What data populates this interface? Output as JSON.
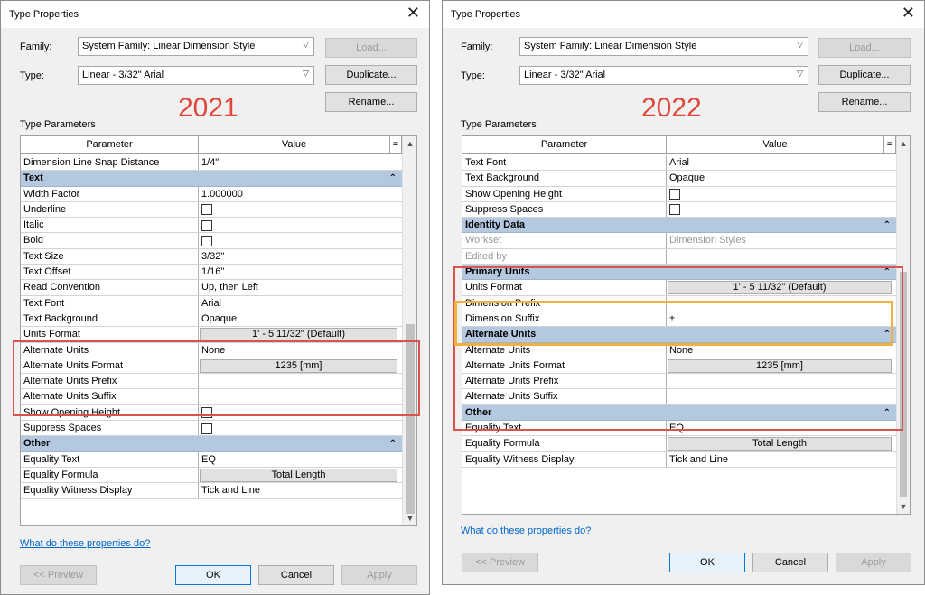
{
  "left": {
    "title": "Type Properties",
    "family_label": "Family:",
    "family_value": "System Family: Linear Dimension Style",
    "type_label": "Type:",
    "type_value": "Linear - 3/32\" Arial",
    "load_label": "Load...",
    "duplicate_label": "Duplicate...",
    "rename_label": "Rename...",
    "year": "2021",
    "params_label": "Type Parameters",
    "col_param": "Parameter",
    "col_value": "Value",
    "col_eq": "=",
    "rows": [
      {
        "kind": "row",
        "p": "Dimension Line Snap Distance",
        "v": "1/4\""
      },
      {
        "kind": "group",
        "p": "Text"
      },
      {
        "kind": "row",
        "p": "Width Factor",
        "v": "1.000000"
      },
      {
        "kind": "check",
        "p": "Underline"
      },
      {
        "kind": "check",
        "p": "Italic"
      },
      {
        "kind": "check",
        "p": "Bold"
      },
      {
        "kind": "row",
        "p": "Text Size",
        "v": "3/32\""
      },
      {
        "kind": "row",
        "p": "Text Offset",
        "v": "1/16\""
      },
      {
        "kind": "row",
        "p": "Read Convention",
        "v": "Up, then Left"
      },
      {
        "kind": "row",
        "p": "Text Font",
        "v": "Arial"
      },
      {
        "kind": "row",
        "p": "Text Background",
        "v": "Opaque"
      },
      {
        "kind": "button",
        "p": "Units Format",
        "v": "1' - 5 11/32\" (Default)"
      },
      {
        "kind": "row",
        "p": "Alternate Units",
        "v": "None"
      },
      {
        "kind": "button",
        "p": "Alternate Units Format",
        "v": "1235 [mm]"
      },
      {
        "kind": "row",
        "p": "Alternate Units Prefix",
        "v": ""
      },
      {
        "kind": "row",
        "p": "Alternate Units Suffix",
        "v": ""
      },
      {
        "kind": "check",
        "p": "Show Opening Height"
      },
      {
        "kind": "check",
        "p": "Suppress Spaces"
      },
      {
        "kind": "group",
        "p": "Other"
      },
      {
        "kind": "row",
        "p": "Equality Text",
        "v": "EQ"
      },
      {
        "kind": "button",
        "p": "Equality Formula",
        "v": "Total Length"
      },
      {
        "kind": "row",
        "p": "Equality Witness Display",
        "v": "Tick and Line"
      }
    ],
    "help_link": "What do these properties do?",
    "preview_label": "<< Preview",
    "ok_label": "OK",
    "cancel_label": "Cancel",
    "apply_label": "Apply"
  },
  "right": {
    "title": "Type Properties",
    "family_label": "Family:",
    "family_value": "System Family: Linear Dimension Style",
    "type_label": "Type:",
    "type_value": "Linear - 3/32\" Arial",
    "load_label": "Load...",
    "duplicate_label": "Duplicate...",
    "rename_label": "Rename...",
    "year": "2022",
    "params_label": "Type Parameters",
    "col_param": "Parameter",
    "col_value": "Value",
    "col_eq": "=",
    "rows": [
      {
        "kind": "row",
        "p": "Text Font",
        "v": "Arial"
      },
      {
        "kind": "row",
        "p": "Text Background",
        "v": "Opaque"
      },
      {
        "kind": "check",
        "p": "Show Opening Height"
      },
      {
        "kind": "check",
        "p": "Suppress Spaces"
      },
      {
        "kind": "group",
        "p": "Identity Data"
      },
      {
        "kind": "grey",
        "p": "Workset",
        "v": "Dimension Styles"
      },
      {
        "kind": "grey",
        "p": "Edited by",
        "v": ""
      },
      {
        "kind": "group",
        "p": "Primary Units"
      },
      {
        "kind": "button",
        "p": "Units Format",
        "v": "1' - 5 11/32\" (Default)"
      },
      {
        "kind": "row",
        "p": "Dimension Prefix",
        "v": ""
      },
      {
        "kind": "row",
        "p": "Dimension Suffix",
        "v": "±"
      },
      {
        "kind": "group",
        "p": "Alternate Units"
      },
      {
        "kind": "row",
        "p": "Alternate Units",
        "v": "None"
      },
      {
        "kind": "button",
        "p": "Alternate Units Format",
        "v": "1235 [mm]"
      },
      {
        "kind": "row",
        "p": "Alternate Units Prefix",
        "v": ""
      },
      {
        "kind": "row",
        "p": "Alternate Units Suffix",
        "v": ""
      },
      {
        "kind": "group",
        "p": "Other"
      },
      {
        "kind": "row",
        "p": "Equality Text",
        "v": "EQ"
      },
      {
        "kind": "button",
        "p": "Equality Formula",
        "v": "Total Length"
      },
      {
        "kind": "row",
        "p": "Equality Witness Display",
        "v": "Tick and Line"
      }
    ],
    "help_link": "What do these properties do?",
    "preview_label": "<< Preview",
    "ok_label": "OK",
    "cancel_label": "Cancel",
    "apply_label": "Apply"
  },
  "icons": {
    "close": "close-icon",
    "dropdown": "chevron-down-icon",
    "collapse": "double-chevron-up-icon"
  }
}
